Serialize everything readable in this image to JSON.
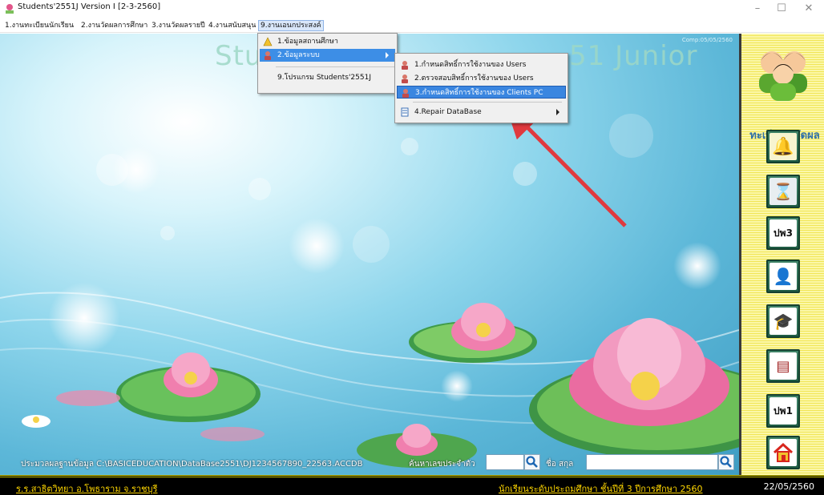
{
  "window": {
    "title": "Students'2551J Version I [2-3-2560]"
  },
  "menubar": {
    "items": [
      "1.งานทะเบียนนักเรียน",
      "2.งานวัดผลการศึกษา",
      "3.งานวัดผลรายปี",
      "4.งานสนับสนุน",
      "9.งานเอนกประสงค์"
    ]
  },
  "main": {
    "big_title_left": "Stu",
    "big_title_right": "51 Junior",
    "comp_text": "Comp:05/05/2560"
  },
  "dropdown": {
    "items": [
      "1.ข้อมูลสถานศึกษา",
      "2.ข้อมูลระบบ",
      "9.โปรแกรม Students'2551J"
    ]
  },
  "submenu": {
    "items": [
      "1.กำหนดสิทธิ์การใช้งานของ Users",
      "2.ตรวจสอบสิทธิ์การใช้งานของ Users",
      "3.กำหนดสิทธิ์การใช้งานของ Clients PC",
      "4.Repair DataBase"
    ]
  },
  "pathbar": {
    "path_label": "ประมวลผลฐานข้อมูล C:\\BASICEDUCATION\\DataBase2551\\DJ1234567890_22563.ACCDB",
    "id_label": "ค้นหาเลขประจำตัว",
    "name_label": "ชื่อ สกุล"
  },
  "footer": {
    "school": "ร.ร.สาธิตวิทยา อ.โพธาราม จ.ราชบุรี",
    "level": "นักเรียนระดับประถมศึกษา ชั้นปีที่ 3 ปีการศึกษา 2560",
    "date": "22/05/2560"
  },
  "sidebar": {
    "title": "ทะเบียน&วัดผล",
    "buttons": [
      "bell",
      "hourglass",
      "ปพ3",
      "student",
      "graduate",
      "records",
      "ปพ1",
      "home"
    ],
    "pp3": "ปพ3",
    "pp1": "ปพ1"
  },
  "colors": {
    "highlight": "#3d8ee6",
    "sidebar_yellow": "#f1e657",
    "footer_gold": "#ffd700",
    "title_blue": "#2e6fa8"
  }
}
